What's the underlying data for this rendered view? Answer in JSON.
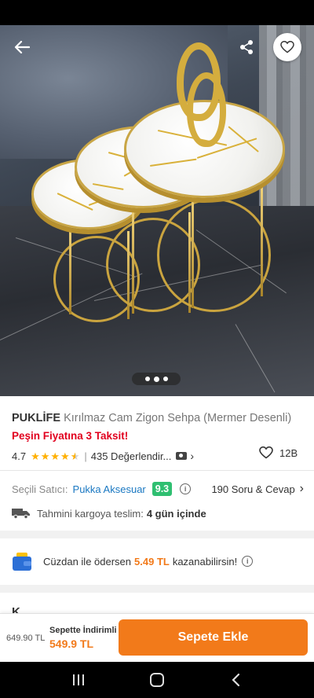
{
  "product": {
    "brand": "PUKLİFE",
    "name": "Kırılmaz Cam Zigon Sehpa (Mermer Desenli)",
    "promo": "Peşin Fiyatına 3 Taksit!",
    "rating": "4.7",
    "rating_stars": 4.7,
    "reviews": "435 Değerlendir...",
    "favorites": "12B"
  },
  "gallery": {
    "image_count": 3,
    "active_index": 1
  },
  "seller": {
    "label": "Seçili Satıcı:",
    "name": "Pukka Aksesuar",
    "score": "9.3",
    "qa_link": "190 Soru & Cevap"
  },
  "delivery": {
    "label": "Tahmini kargoya teslim:",
    "days": "4 gün içinde"
  },
  "wallet": {
    "text_before": "Cüzdan ile ödersen",
    "amount": "5.49 TL",
    "text_after": "kazanabilirsin!"
  },
  "next_section_title": "K",
  "cart": {
    "old_price": "649.90 TL",
    "discount_label": "Sepette İndirimli",
    "price": "549.9 TL",
    "button_label": "Sepete Ekle"
  },
  "colors": {
    "accent": "#f27a1a",
    "promo": "#e1001e",
    "seller_link": "#1a78c2",
    "score_badge": "#2fbf71",
    "star": "#ffb000"
  },
  "icons": {
    "back": "arrow-left-icon",
    "share": "share-icon",
    "favorite": "heart-icon",
    "camera": "camera-icon",
    "info": "info-icon",
    "truck": "truck-icon",
    "wallet": "wallet-icon"
  }
}
